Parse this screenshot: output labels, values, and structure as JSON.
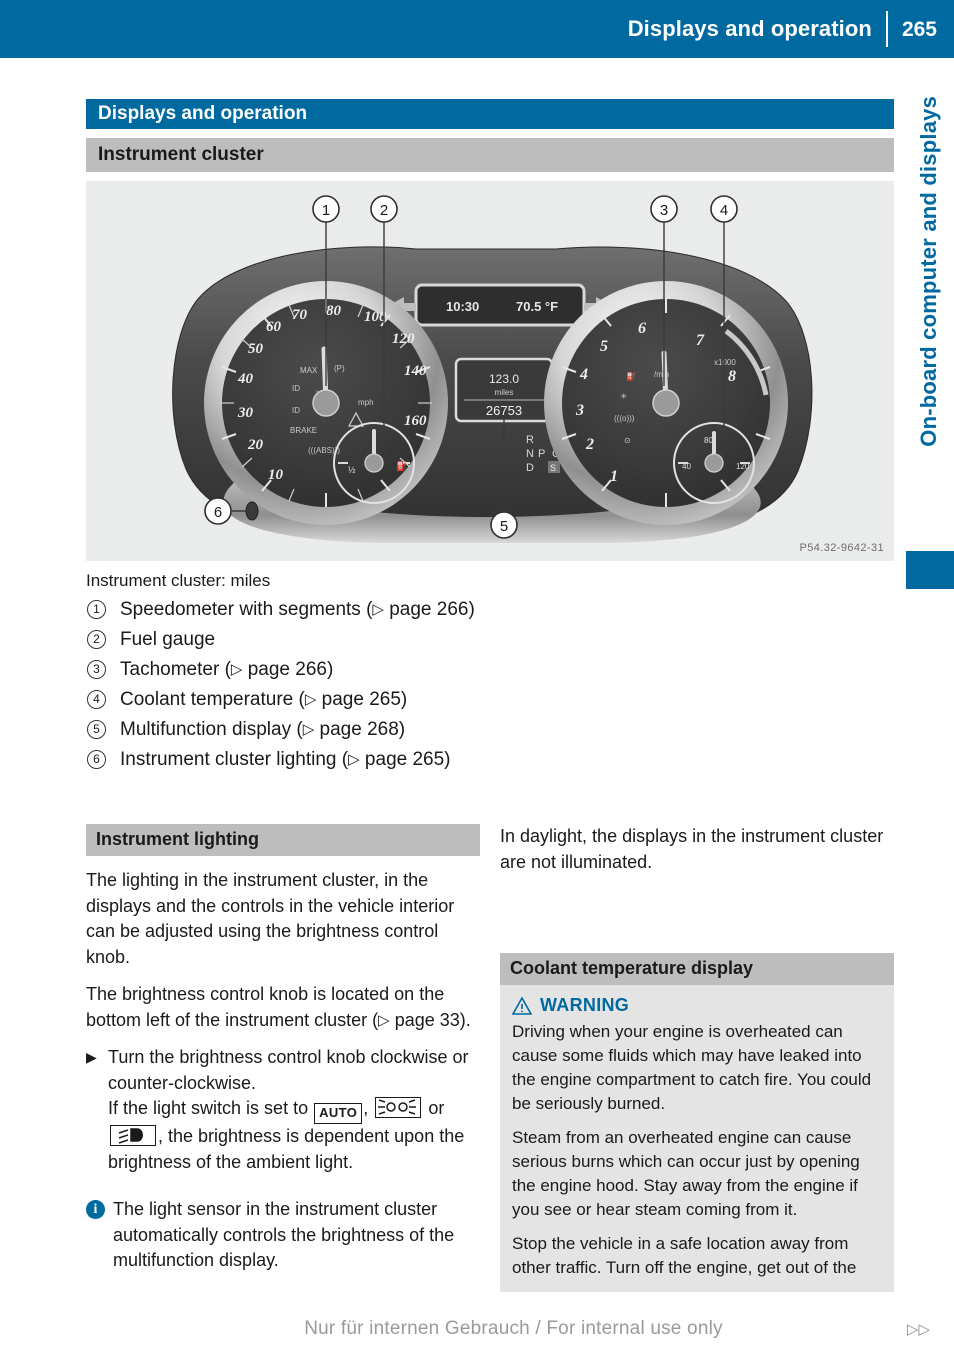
{
  "running_header": {
    "title": "Displays and operation",
    "page_number": "265"
  },
  "side_index": {
    "label": "On-board computer and displays"
  },
  "chapter_bar": {
    "label": "Displays and operation"
  },
  "section_bar": {
    "label": "Instrument cluster"
  },
  "figure": {
    "reference_code": "P54.32-9642-31",
    "display_readouts": {
      "clock": "10:30",
      "temperature": "70.5 °F",
      "trip_distance": "123.0",
      "trip_unit": "miles",
      "odometer": "26753"
    },
    "gear_indicator": [
      "R",
      "N",
      "P",
      "D"
    ],
    "speedometer_ticks": [
      "10",
      "20",
      "30",
      "40",
      "50",
      "60",
      "70",
      "80",
      "100",
      "120",
      "140",
      "160"
    ],
    "tachometer_ticks": [
      "1",
      "2",
      "3",
      "4",
      "5",
      "6",
      "7",
      "8"
    ],
    "callouts": [
      "1",
      "2",
      "3",
      "4",
      "5",
      "6"
    ]
  },
  "legend": {
    "subtitle": "Instrument cluster: miles",
    "items": [
      {
        "num": "1",
        "text": "Speedometer with segments",
        "ref_prefix": "(",
        "ref_page": " page 266)"
      },
      {
        "num": "2",
        "text": "Fuel gauge",
        "ref_prefix": "",
        "ref_page": ""
      },
      {
        "num": "3",
        "text": "Tachometer",
        "ref_prefix": "(",
        "ref_page": " page 266)"
      },
      {
        "num": "4",
        "text": "Coolant temperature",
        "ref_prefix": "(",
        "ref_page": " page 265)"
      },
      {
        "num": "5",
        "text": "Multifunction display",
        "ref_prefix": "(",
        "ref_page": " page 268)"
      },
      {
        "num": "6",
        "text": "Instrument cluster lighting",
        "ref_prefix": "(",
        "ref_page": " page 265)"
      }
    ]
  },
  "left_column": {
    "heading": "Instrument lighting",
    "paragraph_1": "The lighting in the instrument cluster, in the displays and the controls in the vehicle interior can be adjusted using the brightness control knob.",
    "paragraph_2_a": "The brightness control knob is located on the bottom left of the instrument cluster",
    "paragraph_2_ref": " page 33).",
    "step_arrow": "▶",
    "step_line_1": "Turn the brightness control knob clockwise or counter-clockwise.",
    "step_line_2_a": "If the light switch is set to ",
    "step_auto_label": "AUTO",
    "step_line_2_b": ", ",
    "step_line_2_c": " or",
    "step_line_2_d": ", the brightness is dependent upon the brightness of the ambient light.",
    "note_icon_letter": "i",
    "note_text": "The light sensor in the instrument cluster automatically controls the brightness of the multifunction display."
  },
  "right_column": {
    "paragraph_1": "In daylight, the displays in the instrument cluster are not illuminated.",
    "heading": "Coolant temperature display",
    "warning_label": "WARNING",
    "warning_paragraphs": [
      "Driving when your engine is overheated can cause some fluids which may have leaked into the engine compartment to catch fire. You could be seriously burned.",
      "Steam from an overheated engine can cause serious burns which can occur just by opening the engine hood. Stay away from the engine if you see or hear steam coming from it.",
      "Stop the vehicle in a safe location away from other traffic. Turn off the engine, get out of the"
    ]
  },
  "footer": {
    "text": "Nur für internen Gebrauch / For internal use only",
    "mark": "▷▷"
  },
  "colors": {
    "brand_blue": "#0069a0",
    "section_gray": "#bdbdbd",
    "warning_bg": "#e4e4e4",
    "figure_bg": "#eceded"
  }
}
